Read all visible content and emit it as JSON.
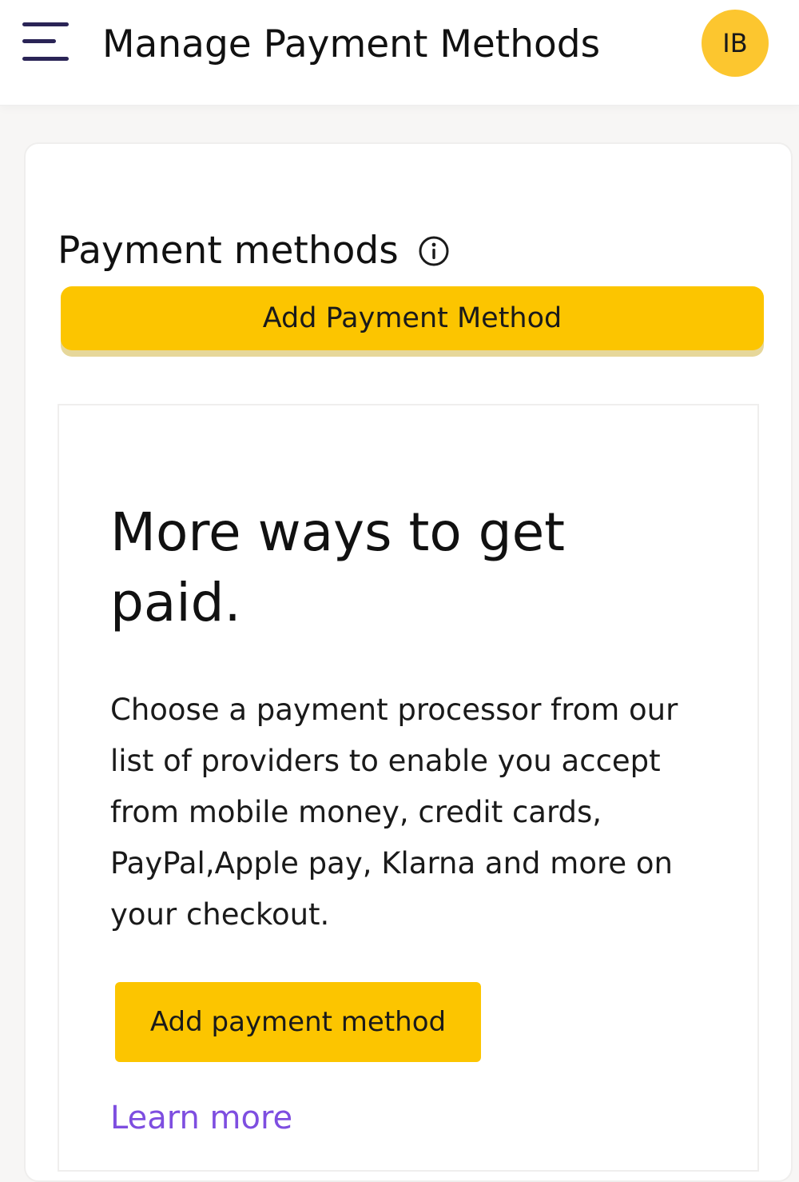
{
  "header": {
    "menu_icon": "hamburger-menu-icon",
    "title": "Manage Payment Methods",
    "avatar_initials": "IB"
  },
  "payment_section": {
    "heading": "Payment methods",
    "info_icon": "info-icon",
    "add_button_label": "Add Payment Method"
  },
  "promo": {
    "headline": "More ways to get paid.",
    "body": "Choose a payment processor from our list of providers to enable you accept from mobile money, credit cards, PayPal,Apple pay, Klarna and more on your checkout.",
    "add_button_label": "Add payment method",
    "learn_more_label": "Learn more"
  },
  "colors": {
    "accent_yellow": "#fcc500",
    "avatar_yellow": "#fcc62f",
    "link_purple": "#7e4ee0",
    "menu_icon": "#2a2456"
  }
}
